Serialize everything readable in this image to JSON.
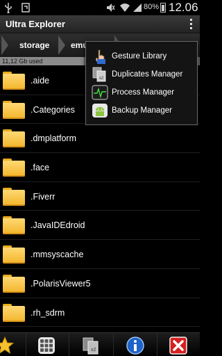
{
  "status_bar": {
    "battery_percent": "80%",
    "time": "12.06"
  },
  "app": {
    "title": "Ultra Explorer"
  },
  "breadcrumb": {
    "items": [
      {
        "label": "storage"
      },
      {
        "label": "emul"
      }
    ]
  },
  "storage": {
    "used_label": "11,12 Gb used",
    "used_fraction": 0.42
  },
  "files": [
    {
      "name": ".aide",
      "icon": "folder-icon"
    },
    {
      "name": ".Categories",
      "icon": "folder-icon"
    },
    {
      "name": ".dmplatform",
      "icon": "folder-icon"
    },
    {
      "name": ".face",
      "icon": "folder-icon"
    },
    {
      "name": ".Fiverr",
      "icon": "folder-icon"
    },
    {
      "name": ".JavaIDEdroid",
      "icon": "folder-icon"
    },
    {
      "name": ".mmsyscache",
      "icon": "folder-icon"
    },
    {
      "name": ".PolarisViewer5",
      "icon": "folder-icon"
    },
    {
      "name": ".rh_sdrm",
      "icon": "folder-icon"
    }
  ],
  "menu": {
    "items": [
      {
        "label": "Gesture Library",
        "icon": "gesture-hand-icon"
      },
      {
        "label": "Duplicates Manager",
        "icon": "duplicates-icon"
      },
      {
        "label": "Process Manager",
        "icon": "process-monitor-icon"
      },
      {
        "label": "Backup Manager",
        "icon": "android-backup-icon"
      }
    ]
  },
  "toolbar": {
    "items": [
      {
        "icon": "star-icon"
      },
      {
        "icon": "grid-icon"
      },
      {
        "icon": "duplicate-copy-icon"
      },
      {
        "icon": "info-icon"
      },
      {
        "icon": "close-icon"
      }
    ]
  },
  "colors": {
    "folder": "#f2b52a",
    "info_blue": "#1e63c8",
    "close_red": "#d61f1f"
  }
}
